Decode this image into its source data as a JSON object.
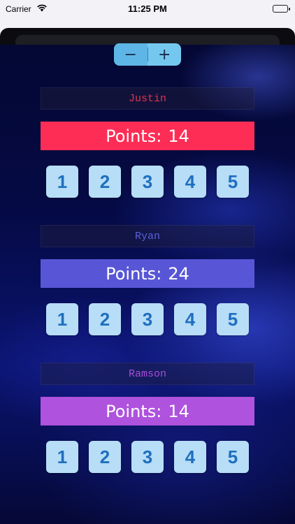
{
  "status_bar": {
    "carrier": "Carrier",
    "time": "11:25 PM",
    "wifi_icon": "wifi-icon",
    "battery_icon": "battery-icon"
  },
  "stepper": {
    "minus_label": "−",
    "plus_label": "+"
  },
  "players": [
    {
      "name": "Justin",
      "name_color": "#e8304e",
      "points_label": "Points:",
      "points": "14",
      "bar_color": "#fe2d55",
      "buttons": [
        "1",
        "2",
        "3",
        "4",
        "5"
      ]
    },
    {
      "name": "Ryan",
      "name_color": "#5a5fd6",
      "points_label": "Points:",
      "points": "24",
      "bar_color": "#5856d6",
      "buttons": [
        "1",
        "2",
        "3",
        "4",
        "5"
      ]
    },
    {
      "name": "Ramson",
      "name_color": "#a44fd6",
      "points_label": "Points:",
      "points": "14",
      "bar_color": "#af52de",
      "buttons": [
        "1",
        "2",
        "3",
        "4",
        "5"
      ]
    }
  ]
}
